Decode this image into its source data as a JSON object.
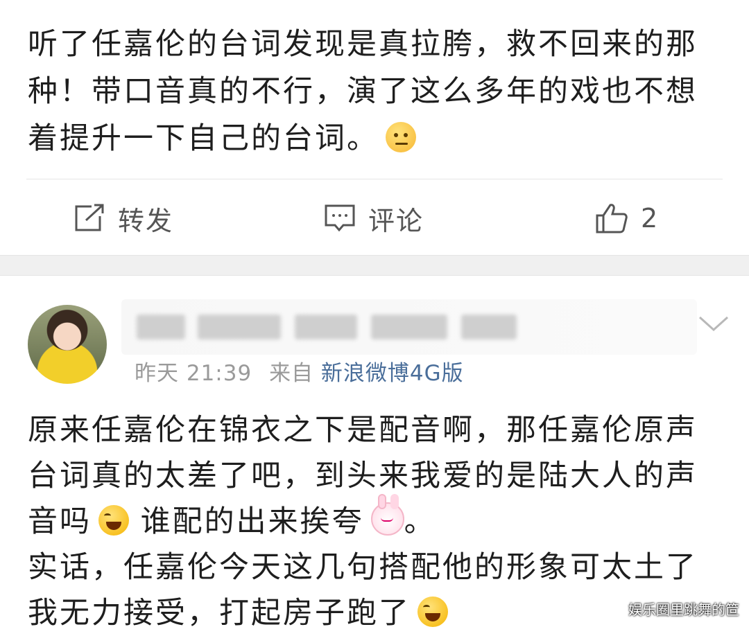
{
  "post": {
    "text": "听了任嘉伦的台词发现是真拉胯，救不回来的那种！带口音真的不行，演了这么多年的戏也不想着提升一下自己的台词。",
    "emoji": "thinking-emoji"
  },
  "actions": {
    "repost_label": "转发",
    "comment_label": "评论",
    "like_count": "2"
  },
  "comment": {
    "time_label": "昨天 21:39",
    "from_label": "来自",
    "source": "新浪微博4G版",
    "text_part1": "原来任嘉伦在锦衣之下是配音啊，那任嘉伦原声台词真的太差了吧，到头来我爱的是陆大人的声音吗",
    "text_part2": " 谁配的出来挨夸",
    "text_part3": "。",
    "text_part4": "实话，任嘉伦今天这几句搭配他的形象可太土了我无力接受，打起房子跑了"
  },
  "watermark": "娱乐圈里跳舞的笸",
  "colors": {
    "source_link": "#4a6e9a",
    "meta": "#9a9a9a",
    "band": "#f0f0f0"
  }
}
